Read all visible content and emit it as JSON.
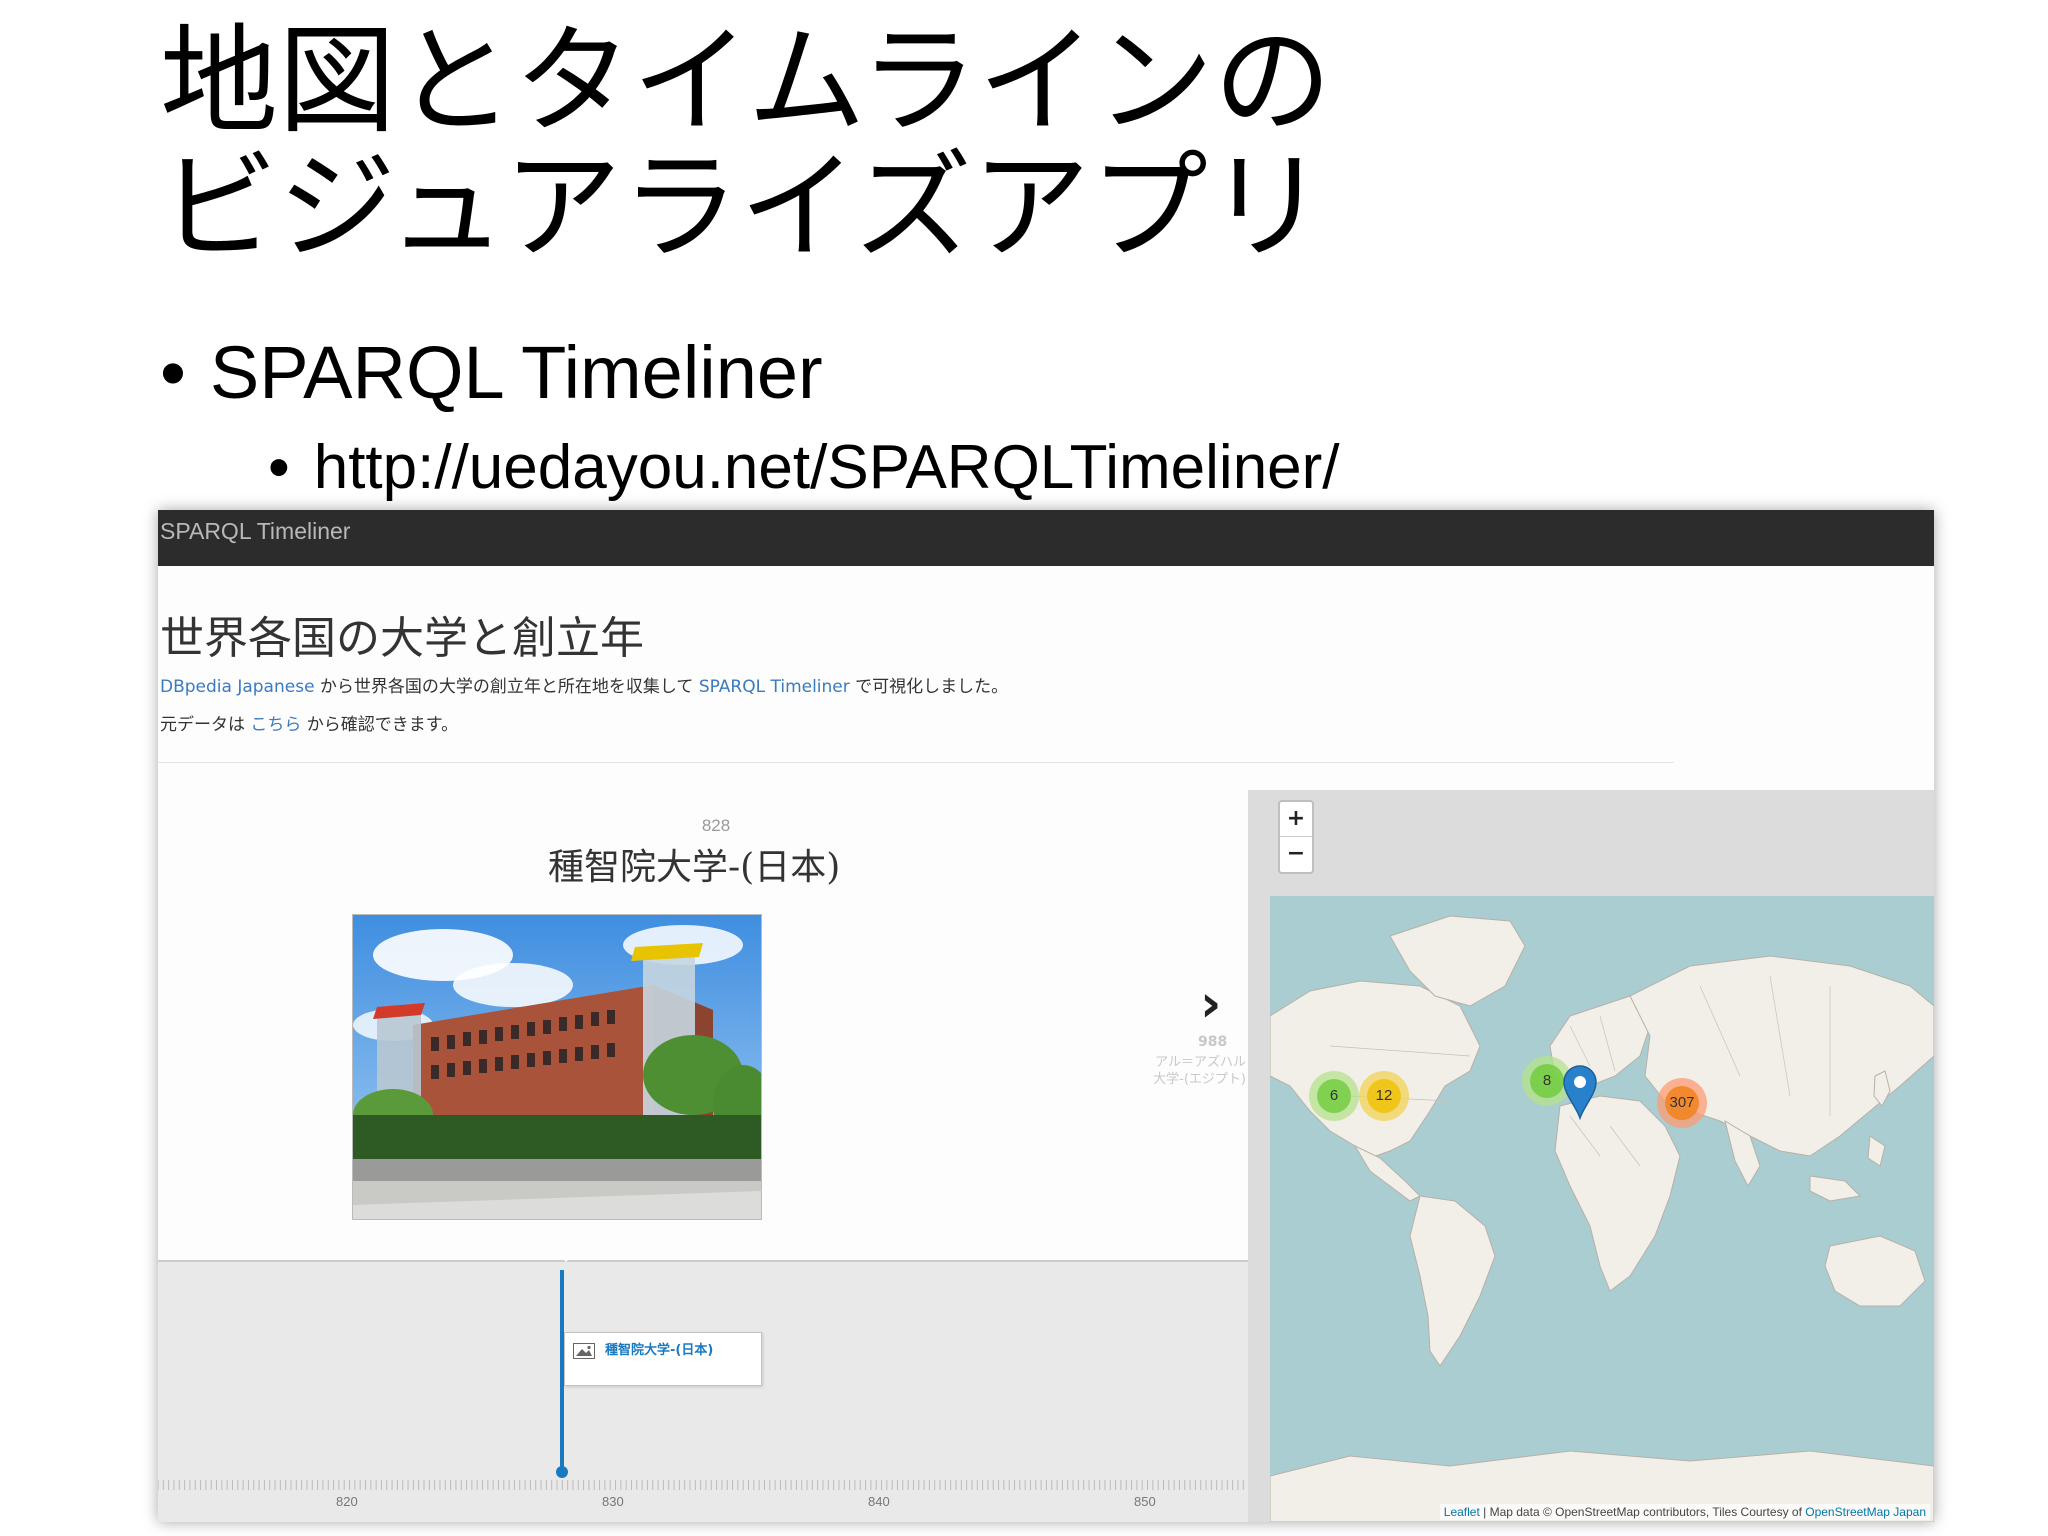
{
  "slide": {
    "title_line1": "地図とタイムラインの",
    "title_line2": "ビジュアライズアプリ",
    "bullet1": "SPARQL Timeliner",
    "bullet2": "http://uedayou.net/SPARQLTimeliner/",
    "bullet_char": "•"
  },
  "app": {
    "brand": "SPARQL Timeliner",
    "heading": "世界各国の大学と創立年",
    "desc1_link1": "DBpedia Japanese",
    "desc1_mid": " から世界各国の大学の創立年と所在地を収集して ",
    "desc1_link2": "SPARQL Timeliner",
    "desc1_end": " で可視化しました。",
    "desc2_start": "元データは ",
    "desc2_link": "こちら",
    "desc2_end": " から確認できます。"
  },
  "timeline": {
    "current_year": "828",
    "current_title": "種智院大学-(日本)",
    "next_arrow": "›",
    "next_year": "988",
    "next_title_line1": "アル＝アズハル",
    "next_title_line2": "大学-(エジプト)",
    "flag_label": "種智院大学-(日本)",
    "tick_labels": [
      "820",
      "830",
      "840",
      "850"
    ]
  },
  "map": {
    "zoom_in": "+",
    "zoom_out": "−",
    "attribution_leaflet": "Leaflet",
    "attribution_mid": " | Map data © OpenStreetMap contributors, Tiles Courtesy of ",
    "attribution_osmjp": "OpenStreetMap Japan",
    "clusters": [
      {
        "count": "6",
        "color": "green"
      },
      {
        "count": "12",
        "color": "yellow"
      },
      {
        "count": "8",
        "color": "green"
      },
      {
        "count": "307",
        "color": "orange"
      }
    ],
    "marker_color": "#2a81cb",
    "land_color": "#f2efe9",
    "water_color": "#a9cdd0"
  },
  "colors": {
    "link": "#3a7bbf",
    "timeline_accent": "#1a7ac0",
    "topbar": "#2c2c2c"
  }
}
